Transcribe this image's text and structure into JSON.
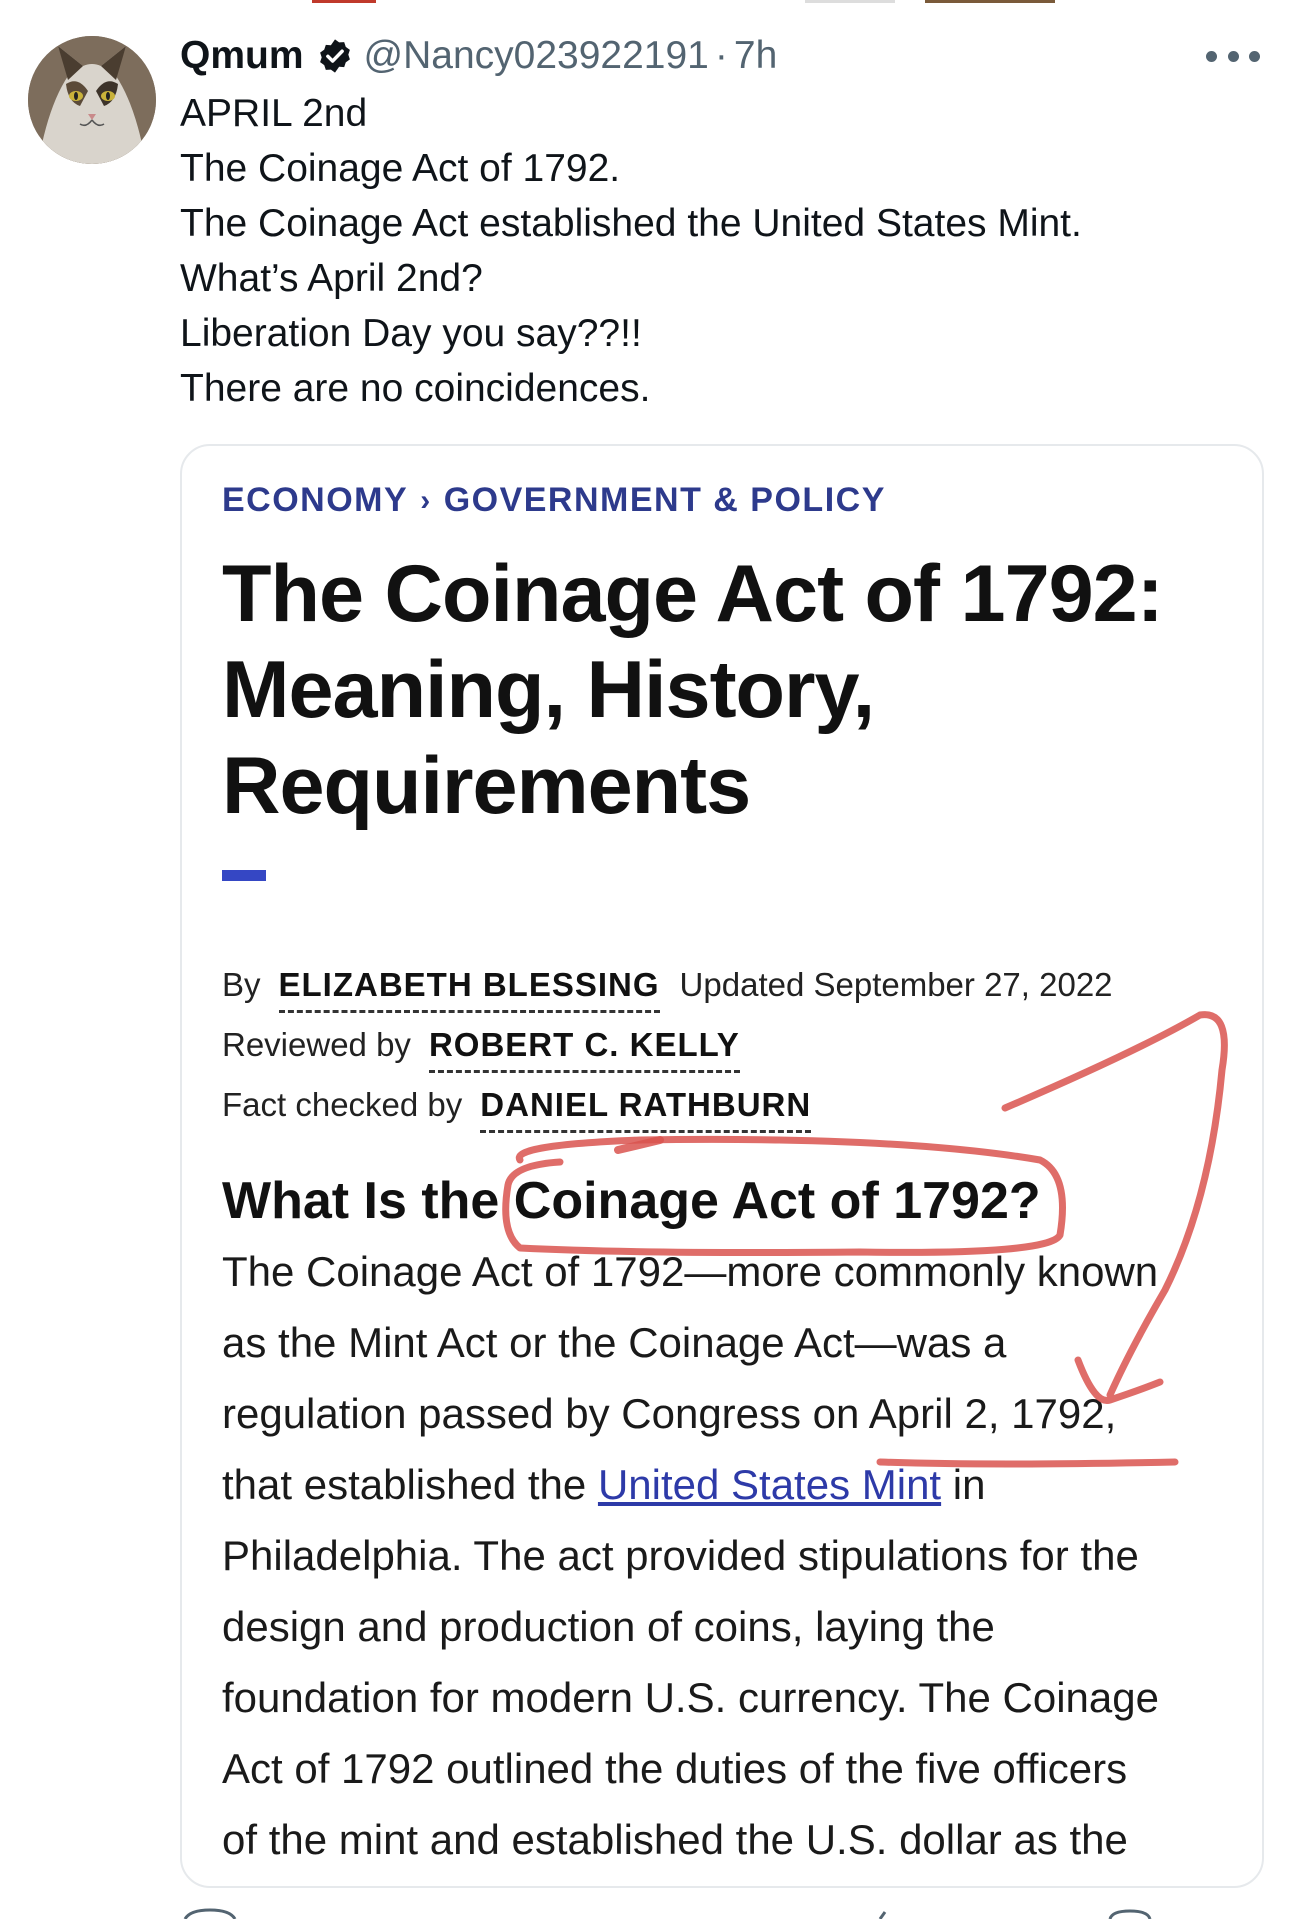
{
  "post": {
    "author_name": "Qmum",
    "handle": "@Nancy023922191",
    "separator": "·",
    "time": "7h",
    "avatar_icon": "cat-photo-avatar",
    "verified_icon": "verified-badge-icon",
    "more_icon": "more-options-icon",
    "lines": [
      "APRIL 2nd",
      "The Coinage Act of 1792.",
      "The Coinage Act established the United States Mint.",
      "What’s April 2nd?",
      "Liberation Day you say??!!",
      "There are no coincidences."
    ]
  },
  "article": {
    "breadcrumb_1": "ECONOMY",
    "breadcrumb_sep": "›",
    "breadcrumb_2": "GOVERNMENT & POLICY",
    "title_lines": [
      "The Coinage Act of 1792:",
      "Meaning, History,",
      "Requirements"
    ],
    "by_label": "By",
    "author": "ELIZABETH BLESSING",
    "updated": "Updated September 27, 2022",
    "reviewed_label": "Reviewed by",
    "reviewer": "ROBERT C. KELLY",
    "factcheck_label": "Fact checked by",
    "factchecker": "DANIEL RATHBURN",
    "section_heading_a": "What Is the ",
    "section_heading_b": "Coinage Act of 1792?",
    "body": {
      "l1": "The Coinage Act of 1792—more commonly known",
      "l2": "as the Mint Act or the Coinage Act—was a",
      "l3a": "regulation passed by Congress on ",
      "l3b": "April 2, 1792,",
      "l4a": "that established the ",
      "l4link": "United States Mint",
      "l4b": " in",
      "l5": "Philadelphia. The act provided stipulations for the",
      "l6": "design and production of coins, laying the",
      "l7": "foundation for modern U.S. currency. The Coinage",
      "l8": "Act of 1792 outlined the duties of the five officers",
      "l9": "of the mint and established the U.S. dollar as the"
    }
  },
  "colors": {
    "accent_blue": "#2d3a8c",
    "link_blue": "#2d3aa8",
    "annotation_red": "#d9534f",
    "muted_text": "#536471"
  }
}
